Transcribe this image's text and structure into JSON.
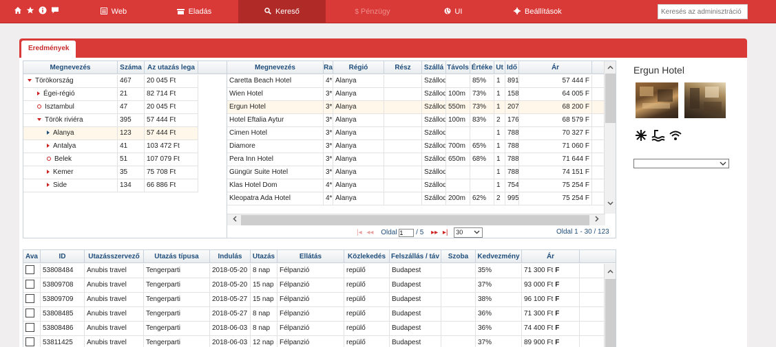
{
  "topnav": {
    "quick_icons": [
      "home-icon",
      "star-icon",
      "info-icon",
      "comment-icon"
    ],
    "items": [
      {
        "label": "Web",
        "icon": "page-icon"
      },
      {
        "label": "Eladás",
        "icon": "cart-icon"
      },
      {
        "label": "Kereső",
        "icon": "search-icon"
      },
      {
        "label": "Pénzügy",
        "icon": "dollar-icon"
      },
      {
        "label": "UI",
        "icon": "globe-icon"
      },
      {
        "label": "Beállítások",
        "icon": "gear-icon"
      }
    ],
    "active": "Kereső",
    "search_placeholder": "Keresés az adminisztráció"
  },
  "tabs": {
    "results": "Eredmények"
  },
  "tree": {
    "columns": [
      "Megnevezés",
      "Száma",
      "Az utazás lega"
    ],
    "rows": [
      {
        "name": "Törökország",
        "count": "467",
        "price": "20 045 Ft",
        "marker": "open"
      },
      {
        "name": "Égei-régió",
        "count": "21",
        "price": "82 714 Ft",
        "marker": "closed"
      },
      {
        "name": "Isztambul",
        "count": "47",
        "price": "20 045 Ft",
        "marker": "leaf"
      },
      {
        "name": "Török riviéra",
        "count": "395",
        "price": "57 444 Ft",
        "marker": "open"
      },
      {
        "name": "Alanya",
        "count": "123",
        "price": "57 444 Ft",
        "marker": "selected"
      },
      {
        "name": "Antalya",
        "count": "41",
        "price": "103 472 Ft",
        "marker": "closed"
      },
      {
        "name": "Belek",
        "count": "51",
        "price": "107 079 Ft",
        "marker": "leaf"
      },
      {
        "name": "Kemer",
        "count": "35",
        "price": "75 708 Ft",
        "marker": "closed"
      },
      {
        "name": "Side",
        "count": "134",
        "price": "66 886 Ft",
        "marker": "closed"
      }
    ]
  },
  "hotels": {
    "columns": [
      "Megnevezés",
      "Ra",
      "Régió",
      "Rész",
      "Szállá",
      "Távols",
      "Értéke",
      "Ut",
      "Idő",
      "Ár"
    ],
    "rows": [
      [
        "Caretta Beach Hotel",
        "4*",
        "Alanya",
        "",
        "Szálloda",
        "",
        "85%",
        "1",
        "891",
        "57 444 F"
      ],
      [
        "Wien Hotel",
        "3*",
        "Alanya",
        "",
        "Szálloda",
        "100m",
        "73%",
        "1",
        "158",
        "64 005 F"
      ],
      [
        "Ergun Hotel",
        "3*",
        "Alanya",
        "",
        "Szálloda",
        "550m",
        "73%",
        "1",
        "207",
        "68 200 F"
      ],
      [
        "Hotel Eftalia Aytur",
        "3*",
        "Alanya",
        "",
        "Szálloda",
        "100m",
        "83%",
        "2",
        "176",
        "68 579 F"
      ],
      [
        "Cimen Hotel",
        "3*",
        "Alanya",
        "",
        "Szálloda",
        "",
        "",
        "1",
        "788",
        "70 327 F"
      ],
      [
        "Diamore",
        "3*",
        "Alanya",
        "",
        "Szálloda",
        "700m",
        "65%",
        "1",
        "788",
        "71 060 F"
      ],
      [
        "Pera Inn Hotel",
        "3*",
        "Alanya",
        "",
        "Szálloda",
        "650m",
        "68%",
        "1",
        "788",
        "71 644 F"
      ],
      [
        "Güngür Suite Hotel",
        "3*",
        "Alanya",
        "",
        "Szálloda",
        "",
        "",
        "1",
        "788",
        "74 151 F"
      ],
      [
        "Klas Hotel Dom",
        "4*",
        "Alanya",
        "",
        "Szálloda",
        "",
        "",
        "1",
        "754",
        "75 254 F"
      ],
      [
        "Kleopatra Ada Hotel",
        "4*",
        "Alanya",
        "",
        "Szálloda",
        "200m",
        "62%",
        "2",
        "995",
        "75 254 F"
      ]
    ],
    "selected_index": 2,
    "pager": {
      "page_label": "Oldal",
      "page": "1",
      "of": "/ 5",
      "per_page": "30",
      "summary": "Oldal 1 - 30 / 123"
    }
  },
  "detail": {
    "title": "Ergun Hotel",
    "amenities": [
      "air-conditioning-icon",
      "pool-icon",
      "wifi-icon"
    ],
    "select_value": ""
  },
  "offers": {
    "columns": [
      "Ava",
      "ID",
      "Utazásszervező",
      "Utazás típusa",
      "Indulás",
      "Utazás",
      "Ellátás",
      "Közlekedés",
      "Felszállás / táv",
      "Szoba",
      "Kedvezmény",
      "Ár"
    ],
    "rows": [
      [
        "",
        "53808484",
        "Anubis travel",
        "Tengerparti",
        "2018-05-20",
        "8 nap",
        "Félpanzió",
        "repülő",
        "Budapest",
        "",
        "35%",
        "71 300 Ft"
      ],
      [
        "",
        "53809708",
        "Anubis travel",
        "Tengerparti",
        "2018-05-20",
        "15 nap",
        "Félpanzió",
        "repülő",
        "Budapest",
        "",
        "37%",
        "93 000 Ft"
      ],
      [
        "",
        "53809709",
        "Anubis travel",
        "Tengerparti",
        "2018-05-27",
        "15 nap",
        "Félpanzió",
        "repülő",
        "Budapest",
        "",
        "38%",
        "96 100 Ft"
      ],
      [
        "",
        "53808485",
        "Anubis travel",
        "Tengerparti",
        "2018-05-27",
        "8 nap",
        "Félpanzió",
        "repülő",
        "Budapest",
        "",
        "36%",
        "71 300 Ft"
      ],
      [
        "",
        "53808486",
        "Anubis travel",
        "Tengerparti",
        "2018-06-03",
        "8 nap",
        "Félpanzió",
        "repülő",
        "Budapest",
        "",
        "36%",
        "74 400 Ft"
      ],
      [
        "",
        "53811425",
        "Anubis travel",
        "Tengerparti",
        "2018-06-03",
        "12 nap",
        "Félpanzió",
        "repülő",
        "Budapest",
        "",
        "37%",
        "89 900 Ft"
      ]
    ],
    "price_suffix": "F"
  },
  "colors": {
    "brand": "#d93a38",
    "brand_dark": "#b02a28",
    "header_text": "#1f4d7a"
  }
}
